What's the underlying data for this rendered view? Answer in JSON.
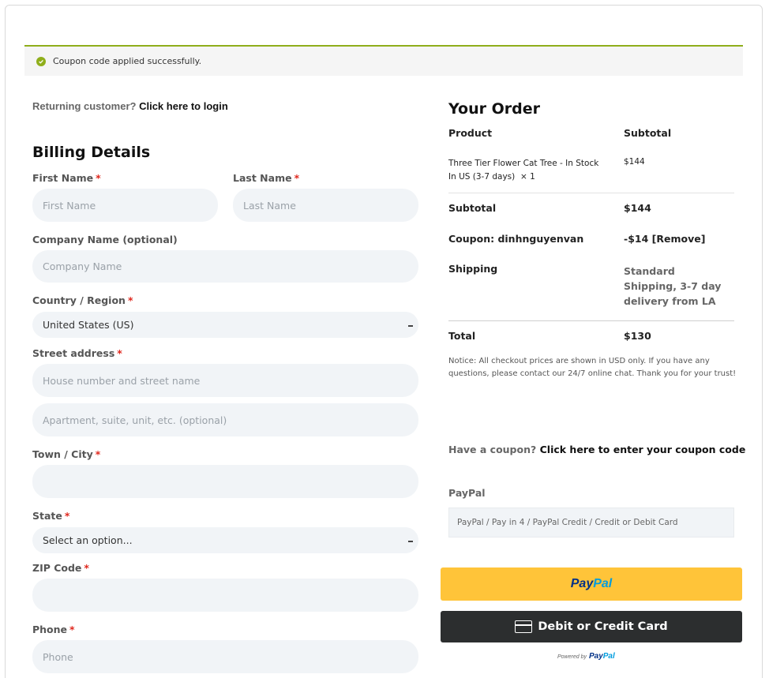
{
  "notice": {
    "message": "Coupon code applied successfully."
  },
  "returning": {
    "prefix": "Returning customer?",
    "link": "Click here to login"
  },
  "billing": {
    "title": "Billing Details",
    "first_name": {
      "label": "First Name",
      "required": "*",
      "placeholder": "First Name"
    },
    "last_name": {
      "label": "Last Name",
      "required": "*",
      "placeholder": "Last Name"
    },
    "company": {
      "label": "Company Name (optional)",
      "placeholder": "Company Name"
    },
    "country": {
      "label": "Country / Region",
      "required": "*",
      "value": "United States (US)"
    },
    "street": {
      "label": "Street address",
      "required": "*",
      "placeholder": "House number and street name",
      "placeholder2": "Apartment, suite, unit, etc. (optional)"
    },
    "city": {
      "label": "Town / City",
      "required": "*"
    },
    "state": {
      "label": "State",
      "required": "*",
      "value": "Select an option..."
    },
    "zip": {
      "label": "ZIP Code",
      "required": "*"
    },
    "phone": {
      "label": "Phone",
      "required": "*",
      "placeholder": "Phone"
    }
  },
  "order": {
    "title": "Your Order",
    "col_product": "Product",
    "col_subtotal": "Subtotal",
    "item": {
      "name": "Three Tier Flower Cat Tree - In Stock In US (3-7 days)",
      "qty": "× 1",
      "price": "$144"
    },
    "subtotal": {
      "label": "Subtotal",
      "value": "$144"
    },
    "coupon": {
      "label": "Coupon: dinhnguyenvan",
      "value": "-$14",
      "remove": "[Remove]"
    },
    "shipping": {
      "label": "Shipping",
      "value": "Standard Shipping, 3-7 day delivery from LA"
    },
    "total": {
      "label": "Total",
      "value": "$130"
    },
    "notice": "Notice: All checkout prices are shown in USD only. If you have any questions, please contact our 24/7 online chat. Thank you for your trust!"
  },
  "coupon_prompt": {
    "prefix": "Have a coupon?",
    "link": "Click here to enter your coupon code"
  },
  "payment": {
    "label": "PayPal",
    "description": "PayPal / Pay in 4 / PayPal Credit / Credit or Debit Card",
    "paypal_button": {
      "part1": "Pay",
      "part2": "Pal"
    },
    "card_button": "Debit or Credit Card",
    "powered_by": "Powered by",
    "colors": {
      "paypal_yellow": "#ffc439",
      "paypal_blue": "#003087",
      "paypal_light": "#009cde",
      "card_dark": "#2c2e2f"
    }
  }
}
